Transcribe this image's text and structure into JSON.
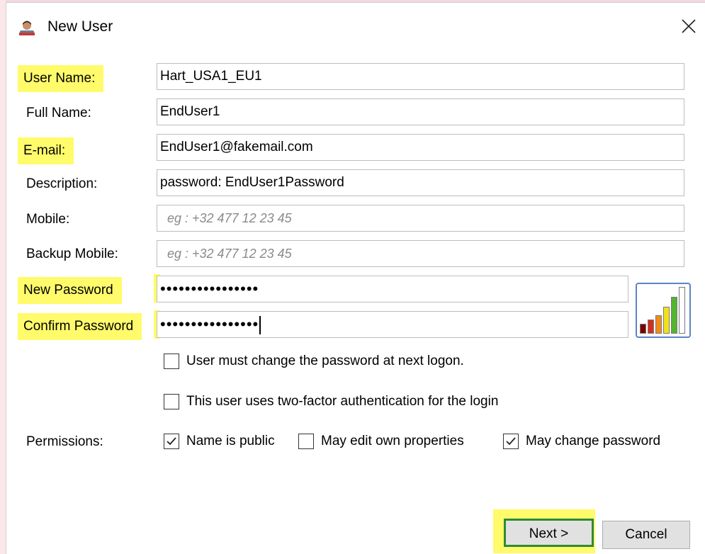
{
  "window": {
    "title": "New User",
    "app_icon": "user-icon",
    "close_icon": "close-icon"
  },
  "form": {
    "username": {
      "label": "User Name:",
      "value": "Hart_USA1_EU1"
    },
    "fullname": {
      "label": "Full Name:",
      "value": "EndUser1"
    },
    "email": {
      "label": "E-mail:",
      "value": "EndUser1@fakemail.com"
    },
    "description": {
      "label": "Description:",
      "value": "password: EndUser1Password"
    },
    "mobile": {
      "label": "Mobile:",
      "placeholder": "eg : +32 477 12 23 45"
    },
    "backup_mobile": {
      "label": "Backup Mobile:",
      "placeholder": "eg : +32 477 12 23 45"
    },
    "new_password": {
      "label": "New Password",
      "value": "••••••••••••••••"
    },
    "confirm_password": {
      "label": "Confirm Password",
      "value": "••••••••••••••••"
    }
  },
  "password_strength": {
    "icon": "password-strength-icon",
    "level": 5,
    "max": 6
  },
  "options": {
    "must_change": {
      "label": "User must change the password at next logon.",
      "checked": false
    },
    "two_factor": {
      "label": "This user uses two-factor authentication for the login",
      "checked": false
    }
  },
  "permissions": {
    "label": "Permissions:",
    "name_public": {
      "label": "Name is public",
      "checked": true
    },
    "edit_own": {
      "label": "May edit own properties",
      "checked": false
    },
    "change_password": {
      "label": "May change password",
      "checked": true
    }
  },
  "buttons": {
    "next": "Next >",
    "cancel": "Cancel"
  },
  "colors": {
    "highlight": "#fffb6b",
    "next_border": "#2f8a34",
    "strength_border": "#5b84c4"
  }
}
